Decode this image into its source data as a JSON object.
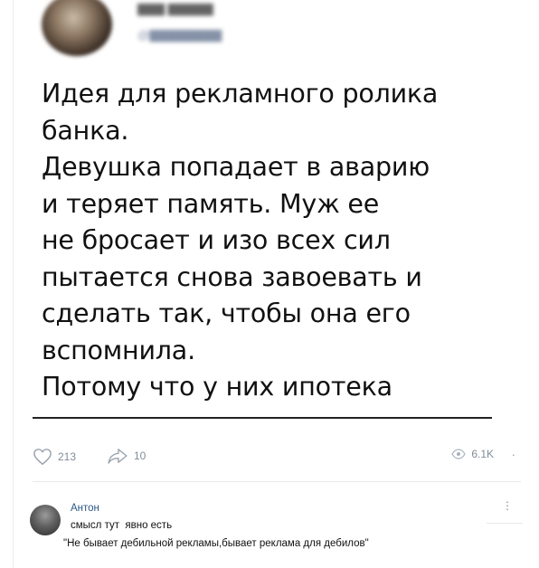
{
  "post": {
    "text_lines": [
      "Идея для рекламного ролика",
      "банка.",
      "Девушка попадает в аварию",
      "и теряет память. Муж ее",
      "не бросает и изо всех сил",
      "пытается снова завоевать и",
      "сделать так, чтобы она его",
      "вспомнила.",
      "Потому что у них ипотека"
    ]
  },
  "actions": {
    "likes": "213",
    "shares": "10",
    "views": "6.1K"
  },
  "comment": {
    "author": "Антон",
    "line1": "смысл тут  явно есть",
    "line2": "\"Не бывает дебильной рекламы,бывает реклама для дебилов\""
  },
  "icons": {
    "like": "heart-outline-icon",
    "share": "share-arrow-icon",
    "views": "eye-icon"
  },
  "colors": {
    "link": "#2a5885",
    "muted": "#818c99"
  }
}
